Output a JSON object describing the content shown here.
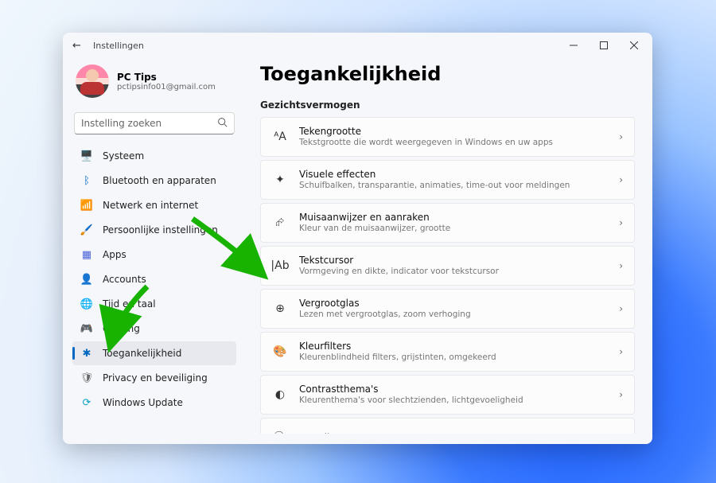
{
  "window": {
    "back_aria": "Terug",
    "app_title": "Instellingen"
  },
  "profile": {
    "name": "PC Tips",
    "email": "pctipsinfo01@gmail.com"
  },
  "search": {
    "placeholder": "Instelling zoeken"
  },
  "sidebar": {
    "items": [
      {
        "icon": "display-icon",
        "glyph": "🖥️",
        "label": "Systeem"
      },
      {
        "icon": "bluetooth-icon",
        "glyph": "ᛒ",
        "label": "Bluetooth en apparaten",
        "color": "#0067c0"
      },
      {
        "icon": "wifi-icon",
        "glyph": "📶",
        "label": "Netwerk en internet",
        "color": "#0aa2c0"
      },
      {
        "icon": "brush-icon",
        "glyph": "🖌️",
        "label": "Persoonlijke instellingen"
      },
      {
        "icon": "apps-icon",
        "glyph": "▦",
        "label": "Apps",
        "color": "#4a62d8"
      },
      {
        "icon": "accounts-icon",
        "glyph": "👤",
        "label": "Accounts"
      },
      {
        "icon": "time-icon",
        "glyph": "🌐",
        "label": "Tijd en taal",
        "color": "#0aa27a"
      },
      {
        "icon": "gaming-icon",
        "glyph": "🎮",
        "label": "Gaming",
        "color": "#777"
      },
      {
        "icon": "accessibility-icon",
        "glyph": "✱",
        "label": "Toegankelijkheid",
        "color": "#0067c0",
        "selected": true
      },
      {
        "icon": "shield-icon",
        "glyph": "🛡",
        "label": "Privacy en beveiliging",
        "color": "#666"
      },
      {
        "icon": "update-icon",
        "glyph": "⟳",
        "label": "Windows Update",
        "color": "#0aa2c0"
      }
    ]
  },
  "main": {
    "title": "Toegankelijkheid",
    "section": "Gezichtsvermogen",
    "rows": [
      {
        "icon": "ᴬA",
        "name": "text-size",
        "title": "Tekengrootte",
        "desc": "Tekstgrootte die wordt weergegeven in Windows en uw apps"
      },
      {
        "icon": "✦",
        "name": "visual-effects",
        "title": "Visuele effecten",
        "desc": "Schuifbalken, transparantie, animaties, time-out voor meldingen"
      },
      {
        "icon": "⮳",
        "name": "mouse-touch",
        "title": "Muisaanwijzer en aanraken",
        "desc": "Kleur van de muisaanwijzer, grootte"
      },
      {
        "icon": "|Ab",
        "name": "text-cursor",
        "title": "Tekstcursor",
        "desc": "Vormgeving en dikte, indicator voor tekstcursor"
      },
      {
        "icon": "⊕",
        "name": "magnifier",
        "title": "Vergrootglas",
        "desc": "Lezen met vergrootglas, zoom verhoging"
      },
      {
        "icon": "🎨",
        "name": "color-filters",
        "title": "Kleurfilters",
        "desc": "Kleurenblindheid filters, grijstinten, omgekeerd"
      },
      {
        "icon": "◐",
        "name": "contrast-themes",
        "title": "Contrastthema's",
        "desc": "Kleurenthema's voor slechtzienden, lichtgevoeligheid"
      },
      {
        "icon": "🗣",
        "name": "narrator",
        "title": "Verteller",
        "desc": ""
      }
    ]
  }
}
